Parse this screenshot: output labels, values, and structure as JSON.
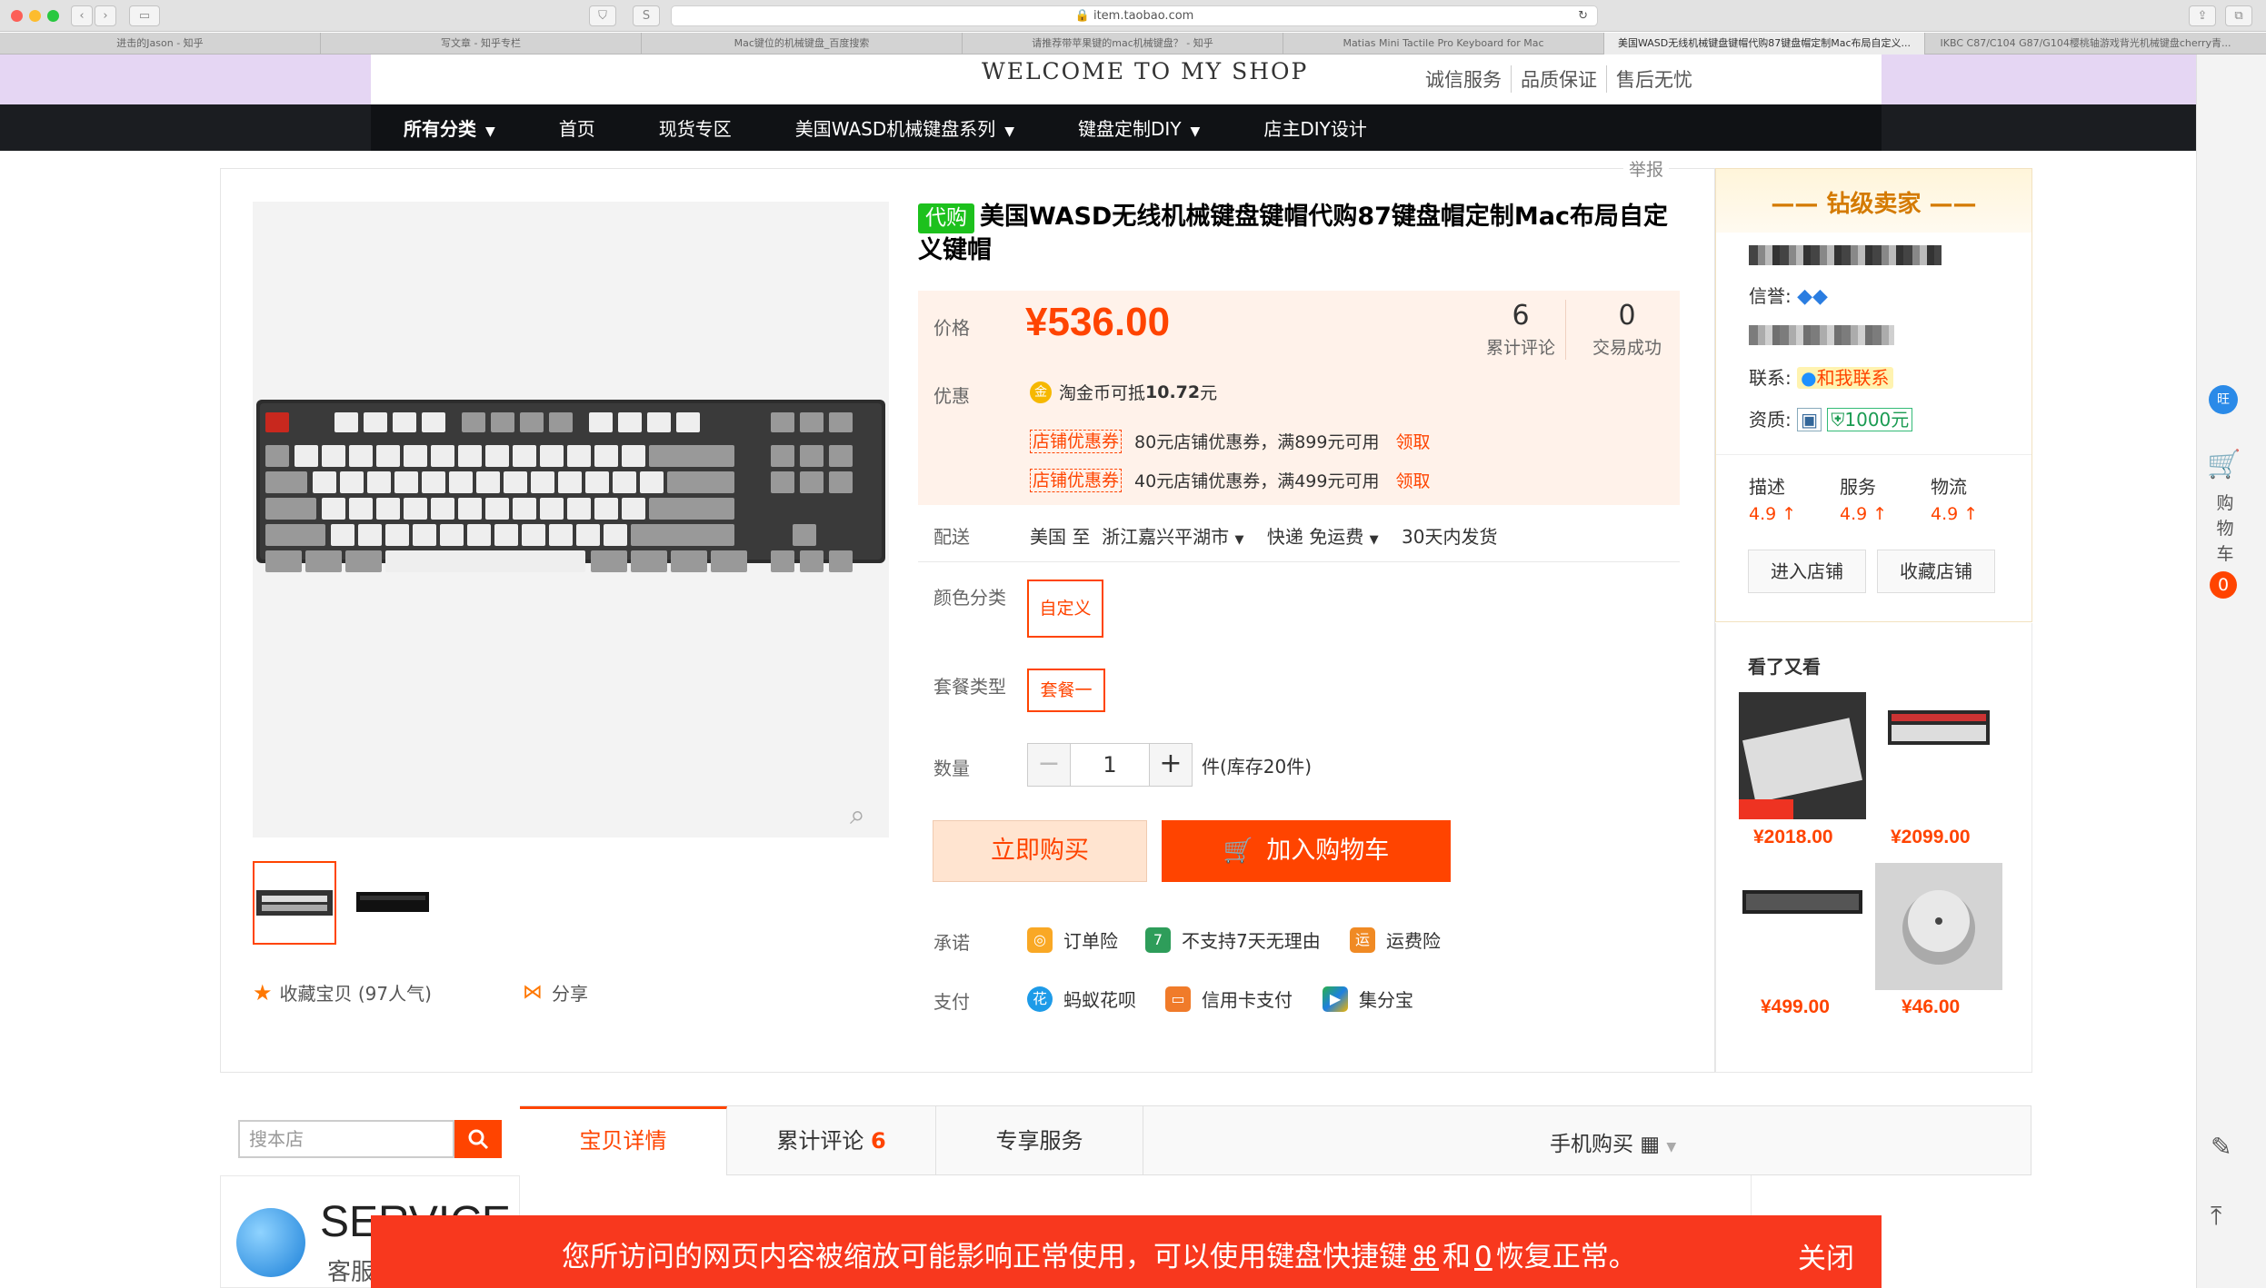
{
  "browser": {
    "url": "item.taobao.com",
    "tabs": [
      "进击的Jason - 知乎",
      "写文章 - 知乎专栏",
      "Mac键位的机械键盘_百度搜索",
      "请推荐带苹果键的mac机械键盘？ - 知乎",
      "Matias Mini Tactile Pro Keyboard for Mac",
      "美国WASD无线机械键盘键帽代购87键盘帽定制Mac布局自定义...",
      "IKBC C87/C104 G87/G104樱桃轴游戏背光机械键盘cherry青..."
    ],
    "active_tab": 5
  },
  "shop": {
    "welcome": "WELCOME TO MY SHOP",
    "guarantees": [
      "诚信服务",
      "品质保证",
      "售后无忧"
    ],
    "nav": [
      "所有分类",
      "首页",
      "现货专区",
      "美国WASD机械键盘系列",
      "键盘定制DIY",
      "店主DIY设计"
    ]
  },
  "product": {
    "report": "举报",
    "badge": "代购",
    "title": "美国WASD无线机械键盘键帽代购87键盘帽定制Mac布局自定义键帽",
    "price_label": "价格",
    "price": "¥536.00",
    "reviews_count": "6",
    "reviews_label": "累计评论",
    "sales_count": "0",
    "sales_label": "交易成功",
    "promo_label": "优惠",
    "coin_text": "淘金币可抵",
    "coin_value": "10.72",
    "coin_unit": "元",
    "coupons": [
      {
        "tag": "店铺优惠券",
        "text": "80元店铺优惠券，满899元可用",
        "link": "领取"
      },
      {
        "tag": "店铺优惠券",
        "text": "40元店铺优惠券，满499元可用",
        "link": "领取"
      }
    ],
    "ship_label": "配送",
    "ship_from": "美国",
    "ship_to_word": "至",
    "ship_to": "浙江嘉兴平湖市",
    "ship_method": "快递 免运费",
    "ship_time": "30天内发货",
    "color_label": "颜色分类",
    "color_option": "自定义",
    "package_label": "套餐类型",
    "package_option": "套餐一",
    "qty_label": "数量",
    "qty_value": "1",
    "stock": "件(库存20件)",
    "buy_now": "立即购买",
    "add_cart": "加入购物车",
    "promise_label": "承诺",
    "promises": [
      "订单险",
      "不支持7天无理由",
      "运费险"
    ],
    "pay_label": "支付",
    "payments": [
      "蚂蚁花呗",
      "信用卡支付",
      "集分宝"
    ],
    "favorite": "收藏宝贝",
    "favorite_count": "(97人气)",
    "share": "分享"
  },
  "seller": {
    "title": "钻级卖家",
    "credit_label": "信誉:",
    "contact_label": "联系:",
    "contact_button": "和我联系",
    "qual_label": "资质:",
    "deposit": "1000元",
    "ratings": [
      {
        "label": "描述",
        "value": "4.9"
      },
      {
        "label": "服务",
        "value": "4.9"
      },
      {
        "label": "物流",
        "value": "4.9"
      }
    ],
    "enter_shop": "进入店铺",
    "fav_shop": "收藏店铺"
  },
  "see_also": {
    "title": "看了又看",
    "items": [
      {
        "price": "¥2018.00"
      },
      {
        "price": "¥2099.00"
      },
      {
        "price": "¥499.00"
      },
      {
        "price": "¥46.00"
      }
    ]
  },
  "sidebar": {
    "cart_label": "购物车",
    "cart_count": "0"
  },
  "detail": {
    "search_placeholder": "搜本店",
    "tabs": [
      "宝贝详情",
      "累计评论",
      "专享服务"
    ],
    "review_count": "6",
    "mobile_buy": "手机购买",
    "service_word": "SERVICE",
    "kefu": "客服"
  },
  "notice": {
    "text_before": "您所访问的网页内容被缩放可能影响正常使用，可以使用键盘快捷键",
    "key1": "⌘",
    "and": "和",
    "key2": "0",
    "text_after": "恢复正常。",
    "close": "关闭"
  }
}
